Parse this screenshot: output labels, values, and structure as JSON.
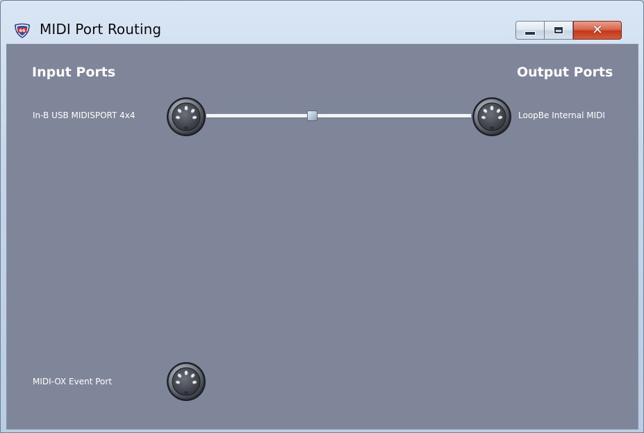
{
  "window": {
    "title": "MIDI Port Routing",
    "app_icon": "route-66-shield-icon",
    "controls": {
      "minimize_icon": "minimize-icon",
      "maximize_icon": "maximize-icon",
      "close_icon": "close-icon",
      "close_glyph": "✕"
    }
  },
  "main": {
    "input_heading": "Input Ports",
    "output_heading": "Output Ports",
    "input_ports": [
      {
        "label": "In-B USB MIDISPORT 4x4",
        "icon": "midi-din-connector-icon"
      },
      {
        "label": "MIDI-OX Event Port",
        "icon": "midi-din-connector-icon"
      }
    ],
    "output_ports": [
      {
        "label": "LoopBe Internal MIDI",
        "icon": "midi-din-connector-icon"
      }
    ],
    "routes": [
      {
        "from": "In-B USB MIDISPORT 4x4",
        "to": "LoopBe Internal MIDI"
      }
    ]
  },
  "colors": {
    "client_background": "#7f8699",
    "route_line": "#f4f5f7",
    "close_button": "#c3371c"
  }
}
